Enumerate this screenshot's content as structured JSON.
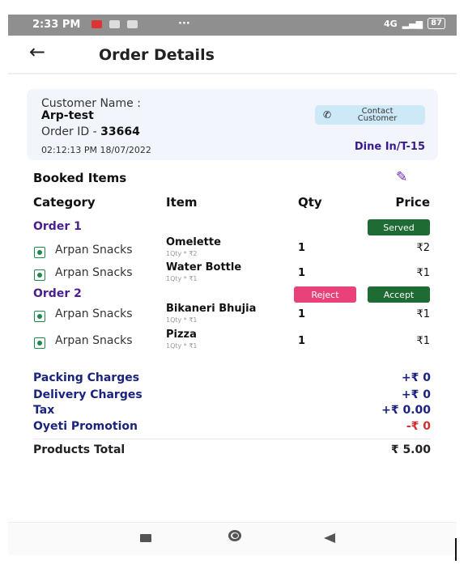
{
  "status_bar": {
    "time": "2:33 PM",
    "dots": "···",
    "network": "4G",
    "battery": "87"
  },
  "header": {
    "title": "Order Details"
  },
  "customer": {
    "name_label": "Customer Name :",
    "name": "Arp-test",
    "order_id_label": "Order ID - ",
    "order_id": "33664",
    "datetime": "02:12:13 PM 18/07/2022",
    "contact_line1": "Contact",
    "contact_line2": "Customer",
    "dine_in": "Dine In/T-15"
  },
  "items_section": {
    "title": "Booked Items",
    "columns": [
      "Category",
      "Item",
      "Qty",
      "Price"
    ],
    "orders": [
      {
        "title": "Order 1",
        "actions": [
          "Served"
        ],
        "items": [
          {
            "category": "Arpan Snacks",
            "name": "Omelette",
            "sub": "1Qty * ₹2",
            "qty": "1",
            "price": "₹2"
          },
          {
            "category": "Arpan Snacks",
            "name": "Water Bottle",
            "sub": "1Qty * ₹1",
            "qty": "1",
            "price": "₹1"
          }
        ]
      },
      {
        "title": "Order 2",
        "actions": [
          "Reject",
          "Accept"
        ],
        "items": [
          {
            "category": "Arpan Snacks",
            "name": "Bikaneri Bhujia",
            "sub": "1Qty * ₹1",
            "qty": "1",
            "price": "₹1"
          },
          {
            "category": "Arpan Snacks",
            "name": "Pizza",
            "sub": "1Qty * ₹1",
            "qty": "1",
            "price": "₹1"
          }
        ]
      }
    ]
  },
  "charges": [
    {
      "label": "Packing Charges",
      "value": "+₹ 0"
    },
    {
      "label": "Delivery Charges",
      "value": "+₹ 0"
    },
    {
      "label": "Tax",
      "value": "+₹ 0.00"
    },
    {
      "label": "Oyeti Promotion",
      "value": "-₹ 0"
    }
  ],
  "total": {
    "label": "Products Total",
    "value": "₹ 5.00"
  },
  "colors": {
    "accent": "#4a1e8f",
    "charges": "#1a237e",
    "served": "#1e6b33",
    "accept": "#1e6b33",
    "reject": "#e9417a",
    "promotion_value": "#d32f2f",
    "veg": "#1f8a4c",
    "contact_bg": "#cde9f8"
  },
  "icons": {
    "back": "arrow-left-icon",
    "contact": "phone-icon",
    "edit": "pencil-icon",
    "veg": "veg-indicator-icon"
  }
}
